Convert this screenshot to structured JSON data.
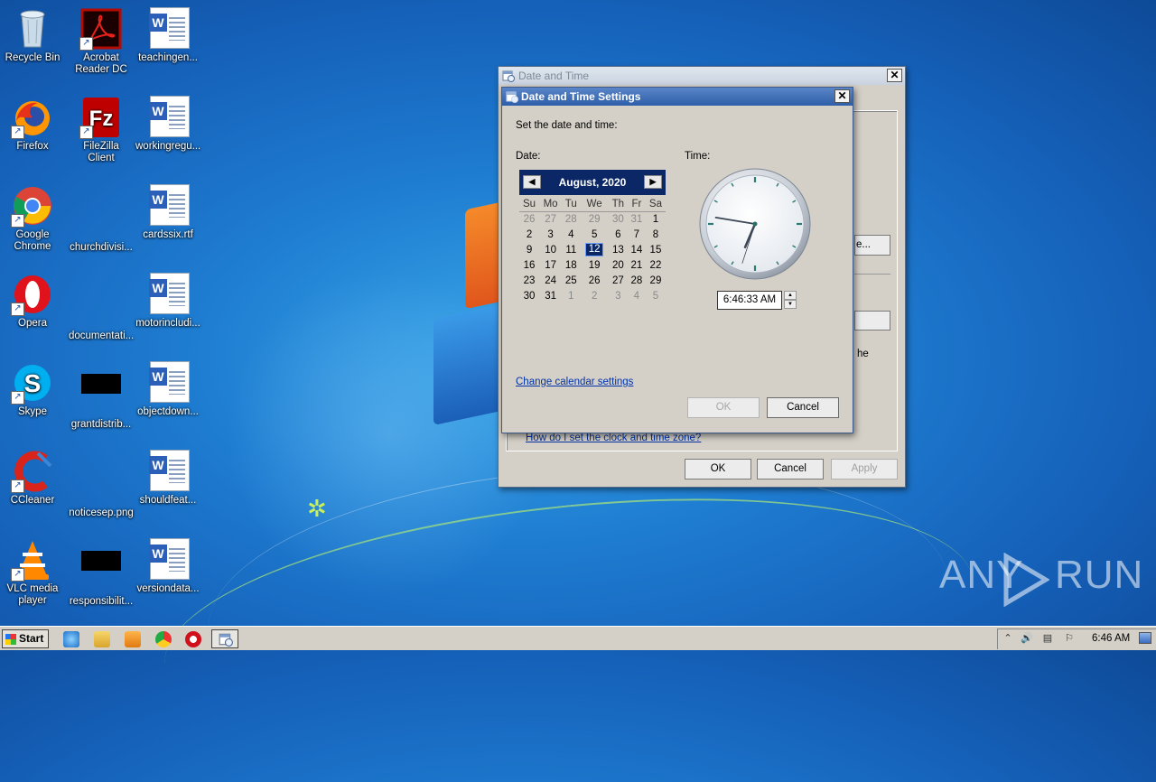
{
  "desktop": {
    "icons": [
      {
        "label": "Recycle Bin"
      },
      {
        "label": "Acrobat Reader DC"
      },
      {
        "label": "teachingen..."
      },
      {
        "label": "Firefox"
      },
      {
        "label": "FileZilla Client"
      },
      {
        "label": "workingregu..."
      },
      {
        "label": "Google Chrome"
      },
      {
        "label": "churchdivisi..."
      },
      {
        "label": "cardssix.rtf"
      },
      {
        "label": "Opera"
      },
      {
        "label": "documentati..."
      },
      {
        "label": "motorincludi..."
      },
      {
        "label": "Skype"
      },
      {
        "label": "grantdistrib..."
      },
      {
        "label": "objectdown..."
      },
      {
        "label": "CCleaner"
      },
      {
        "label": "noticesep.png"
      },
      {
        "label": "shouldfeat..."
      },
      {
        "label": "VLC media player"
      },
      {
        "label": "responsibilit..."
      },
      {
        "label": "versiondata..."
      }
    ]
  },
  "back_window": {
    "title": "Date and Time",
    "partial_button_label": "e...",
    "partial_text": "he",
    "help_link": "How do I set the clock and time zone?",
    "ok_label": "OK",
    "cancel_label": "Cancel",
    "apply_label": "Apply"
  },
  "front_window": {
    "title": "Date and Time Settings",
    "instruction": "Set the date and time:",
    "date_label": "Date:",
    "time_label": "Time:",
    "calendar": {
      "month_year": "August, 2020",
      "weekdays": [
        "Su",
        "Mo",
        "Tu",
        "We",
        "Th",
        "Fr",
        "Sa"
      ],
      "weeks": [
        [
          "26",
          "27",
          "28",
          "29",
          "30",
          "31",
          "1"
        ],
        [
          "2",
          "3",
          "4",
          "5",
          "6",
          "7",
          "8"
        ],
        [
          "9",
          "10",
          "11",
          "12",
          "13",
          "14",
          "15"
        ],
        [
          "16",
          "17",
          "18",
          "19",
          "20",
          "21",
          "22"
        ],
        [
          "23",
          "24",
          "25",
          "26",
          "27",
          "28",
          "29"
        ],
        [
          "30",
          "31",
          "1",
          "2",
          "3",
          "4",
          "5"
        ]
      ],
      "selected_day": "12"
    },
    "clock": {
      "hour": 6,
      "minute": 46,
      "second": 33
    },
    "time_value": "6:46:33 AM",
    "calendar_link": "Change calendar settings",
    "ok_label": "OK",
    "cancel_label": "Cancel"
  },
  "taskbar": {
    "start_label": "Start",
    "clock": "6:46 AM"
  },
  "watermark": {
    "left": "ANY",
    "right": "RUN"
  }
}
